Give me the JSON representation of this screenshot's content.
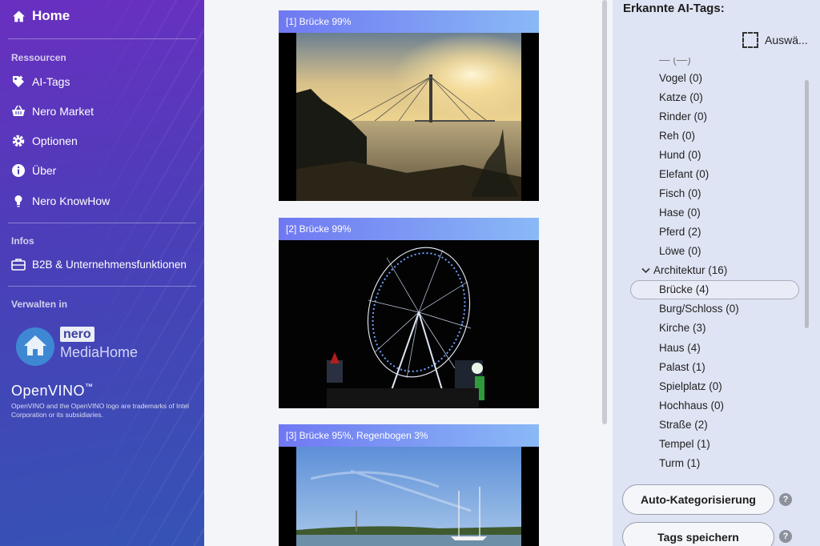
{
  "sidebar": {
    "home_label": "Home",
    "section_resources": "Ressourcen",
    "items": [
      {
        "label": "AI-Tags",
        "icon": "tag-icon"
      },
      {
        "label": "Nero Market",
        "icon": "basket-icon"
      },
      {
        "label": "Optionen",
        "icon": "gear-icon"
      },
      {
        "label": "Über",
        "icon": "info-icon"
      },
      {
        "label": "Nero KnowHow",
        "icon": "lightbulb-icon"
      }
    ],
    "section_infos": "Infos",
    "b2b_label": "B2B & Unternehmensfunktionen",
    "section_manage": "Verwalten in",
    "nero_brand": "nero",
    "mediahome_label": "MediaHome",
    "openvino_label": "OpenVINO",
    "openvino_tm": "™",
    "openvino_note": "OpenVINO and the OpenVINO logo are trademarks of Intel Corporation or its subsidiaries."
  },
  "cards": [
    {
      "label": "[1] Brücke 99%"
    },
    {
      "label": "[2] Brücke 99%"
    },
    {
      "label": "[3] Brücke 95%, Regenbogen 3%"
    }
  ],
  "panel": {
    "title": "Erkannte AI-Tags:",
    "select_all": "Auswä...",
    "tags_animals": [
      "Vogel (0)",
      "Katze (0)",
      "Rinder (0)",
      "Reh (0)",
      "Hund (0)",
      "Elefant (0)",
      "Fisch (0)",
      "Hase (0)",
      "Pferd (2)",
      "Löwe (0)"
    ],
    "architecture_label": "Architektur (16)",
    "tags_architecture": [
      "Brücke (4)",
      "Burg/Schloss (0)",
      "Kirche (3)",
      "Haus (4)",
      "Palast (1)",
      "Spielplatz (0)",
      "Hochhaus (0)",
      "Straße (2)",
      "Tempel (1)",
      "Turm (1)"
    ],
    "auto_button": "Auto-Kategorisierung",
    "save_button": "Tags speichern",
    "help_symbol": "?"
  },
  "colors": {
    "sidebar_top": "#6a2fc0",
    "sidebar_bottom": "#3553b5",
    "card_header_start": "#6f78f2",
    "card_header_end": "#8ab9f6",
    "panel_bg": "#dfe4f4"
  }
}
